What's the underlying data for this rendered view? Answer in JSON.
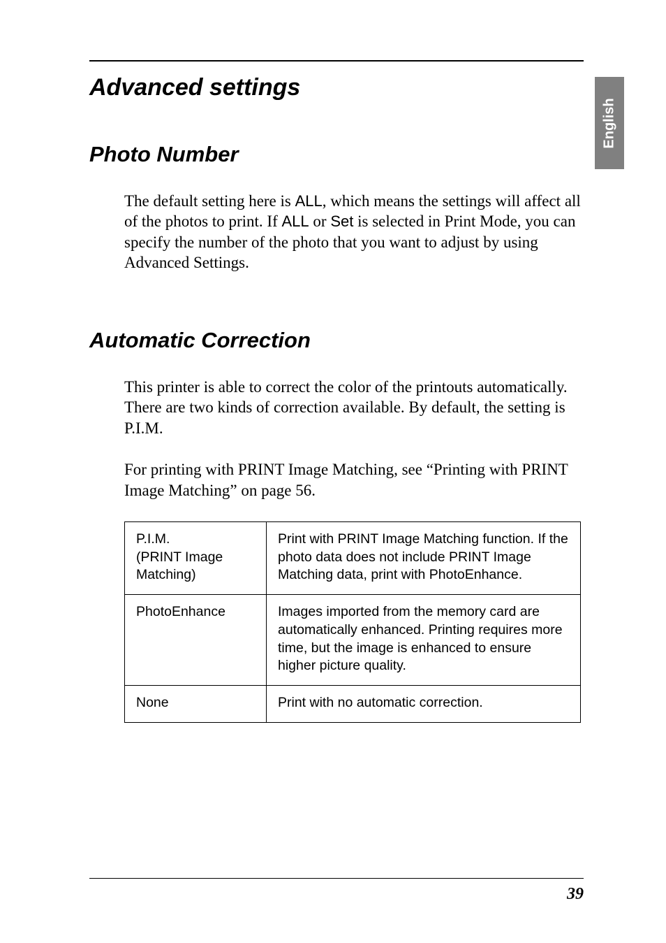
{
  "sideTab": "English",
  "headings": {
    "advancedSettings": "Advanced settings",
    "photoNumber": "Photo Number",
    "automaticCorrection": "Automatic Correction"
  },
  "photoNumber": {
    "p1_a": "The default setting here is ",
    "p1_all": "ALL",
    "p1_b": ", which means the settings will affect all of the photos to print. If ",
    "p1_all2": "ALL",
    "p1_c": " or ",
    "p1_set": "Set",
    "p1_d": " is selected in Print Mode, you can specify the number of the photo that you want to adjust by using Advanced Settings."
  },
  "automaticCorrection": {
    "p1": "This printer is able to correct the color of the printouts automatically. There are two kinds of correction available. By default, the setting is P.I.M.",
    "p2": "For printing with PRINT Image Matching, see “Printing with PRINT Image Matching” on page 56."
  },
  "table": {
    "row1": {
      "term_a": "P.I.M.",
      "term_b": "(PRINT Image Matching)",
      "desc": "Print with PRINT Image Matching function. If the photo data does not include PRINT Image Matching data, print with PhotoEnhance."
    },
    "row2": {
      "term": "PhotoEnhance",
      "desc": "Images imported from the memory card are automatically enhanced. Printing requires more time, but the image is enhanced to ensure higher picture quality."
    },
    "row3": {
      "term": "None",
      "desc": "Print with no automatic correction."
    }
  },
  "pageNumber": "39"
}
